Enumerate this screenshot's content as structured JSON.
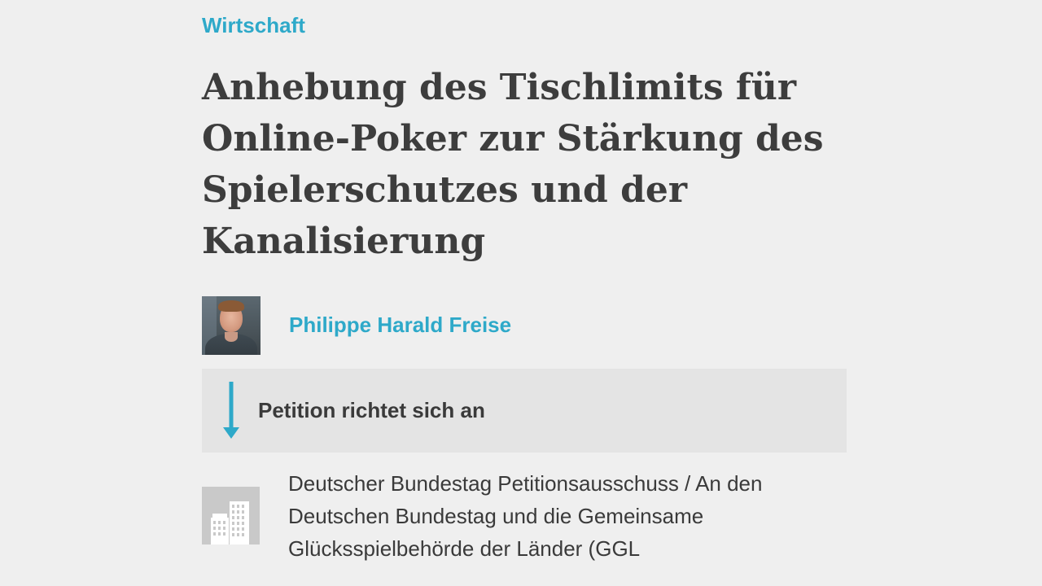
{
  "article": {
    "category": "Wirtschaft",
    "title_lines": [
      "Anhebung des Tischlimits für",
      "Online-Poker zur Stärkung des",
      "Spielerschutzes und der",
      "Kanalisierung"
    ]
  },
  "author": {
    "name": "Philippe Harald Freise"
  },
  "petition_target": {
    "heading": "Petition richtet sich an",
    "recipient_lines": [
      "Deutscher Bundestag Petitionsausschuss / An den",
      "Deutschen Bundestag und die Gemeinsame",
      "Glücksspielbehörde der Länder (GGL"
    ]
  },
  "colors": {
    "accent": "#2ea9c9",
    "text": "#3d3d3d",
    "background": "#efefef",
    "panel": "#e4e4e4",
    "icon_bg": "#c9c9c9"
  },
  "icons": {
    "arrow": "arrow-down-icon",
    "building": "building-icon",
    "avatar": "avatar"
  }
}
